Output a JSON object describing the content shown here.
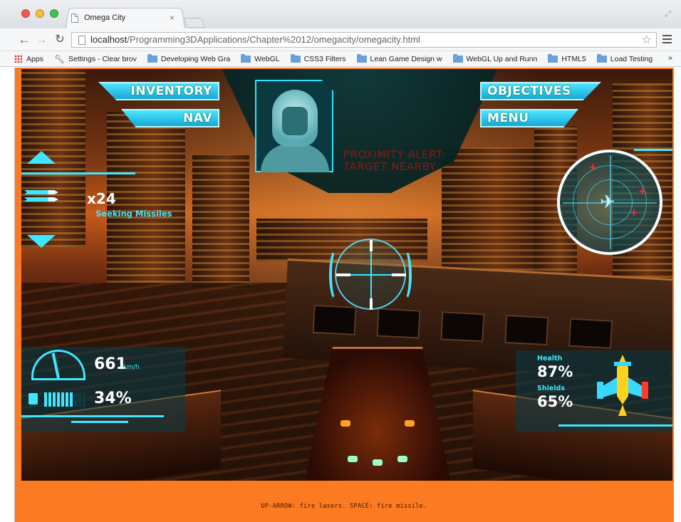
{
  "browser": {
    "tab_title": "Omega City",
    "tab_close": "×",
    "url_host": "localhost",
    "url_path": "/Programming3DApplications/Chapter%2012/omegacity/omegacity.html",
    "star": "☆",
    "bookmarks": [
      {
        "label": "Apps",
        "icon": "apps-grid-icon"
      },
      {
        "label": "Settings - Clear brov",
        "icon": "wrench-icon"
      },
      {
        "label": "Developing Web Gra",
        "icon": "folder-icon"
      },
      {
        "label": "WebGL",
        "icon": "folder-icon"
      },
      {
        "label": "CSS3 Filters",
        "icon": "folder-icon"
      },
      {
        "label": "Lean Game Design w",
        "icon": "folder-icon"
      },
      {
        "label": "WebGL Up and Runn",
        "icon": "folder-icon"
      },
      {
        "label": "HTML5",
        "icon": "folder-icon"
      },
      {
        "label": "Load Testing",
        "icon": "folder-icon"
      }
    ],
    "bookmarks_more": "»"
  },
  "hud": {
    "inventory": "INVENTORY",
    "nav": "NAV",
    "objectives": "OBJECTIVES",
    "menu": "MENU",
    "alert_line1": "PROXIMITY ALERT:",
    "alert_line2": "TARGET NEARBY",
    "missile_count": "x24",
    "missile_label": "Seeking Missiles",
    "speed_value": "661",
    "speed_unit": "km/h",
    "fuel_value": "34%",
    "fuel_level": 0.65,
    "health_label": "Health",
    "health_value": "87%",
    "shields_label": "Shields",
    "shields_value": "65%",
    "accent_color": "#3fe6ff",
    "alert_color": "#9a1a10"
  },
  "footer": {
    "instructions": "UP-ARROW: fire lasers. SPACE: fire missile."
  }
}
